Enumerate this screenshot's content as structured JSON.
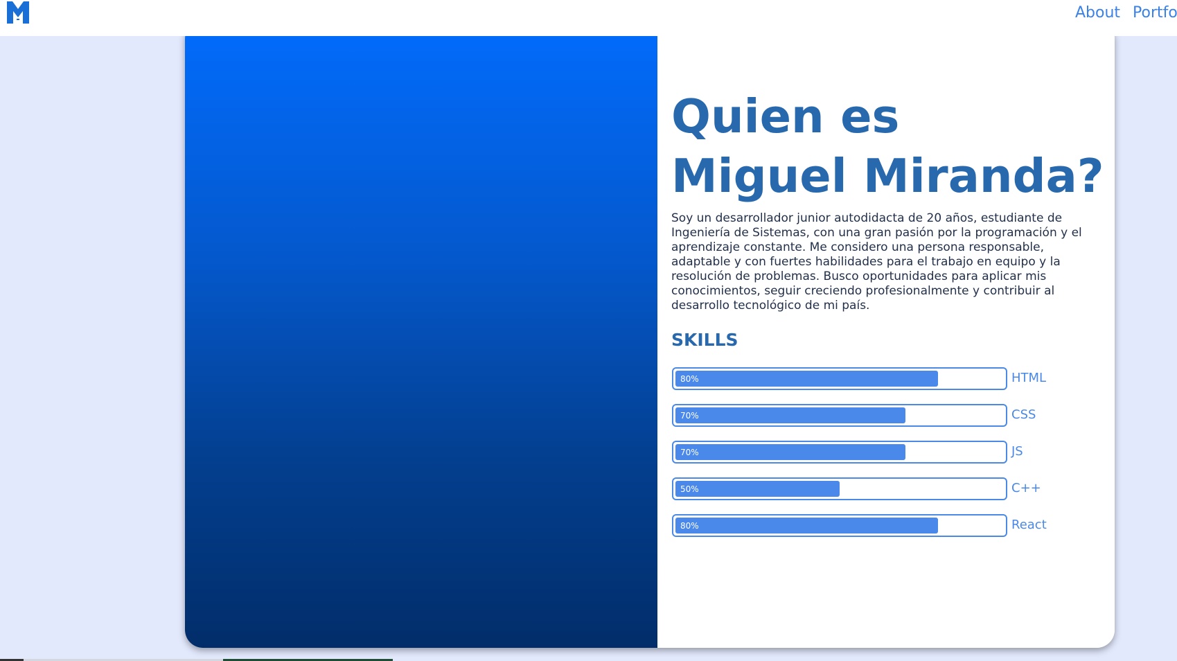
{
  "nav": {
    "logo_icon": "m-logo-icon",
    "links": [
      "About",
      "Portfolio"
    ]
  },
  "about": {
    "title_line1": "Quien es",
    "title_line2": "Miguel Miranda?",
    "description": "Soy un desarrollador junior autodidacta de 20 años, estudiante de Ingeniería de Sistemas, con una gran pasión por la programación y el aprendizaje constante. Me considero una persona responsable, adaptable y con fuertes habilidades para el trabajo en equipo y la resolución de problemas. Busco oportunidades para aplicar mis conocimientos, seguir creciendo profesionalmente y contribuir al desarrollo tecnológico de mi país.",
    "skills_heading": "SKILLS",
    "skills": [
      {
        "percent_label": "80%",
        "value": 80,
        "name": "HTML"
      },
      {
        "percent_label": "70%",
        "value": 70,
        "name": "CSS"
      },
      {
        "percent_label": "70%",
        "value": 70,
        "name": "JS"
      },
      {
        "percent_label": "50%",
        "value": 50,
        "name": "C++"
      },
      {
        "percent_label": "80%",
        "value": 80,
        "name": "React"
      }
    ]
  },
  "colors": {
    "accent": "#2869ae",
    "bar": "#4a88ea",
    "page_bg": "#e3e9fd",
    "gradient_top": "#026cfd",
    "gradient_bottom": "#022d6a"
  }
}
